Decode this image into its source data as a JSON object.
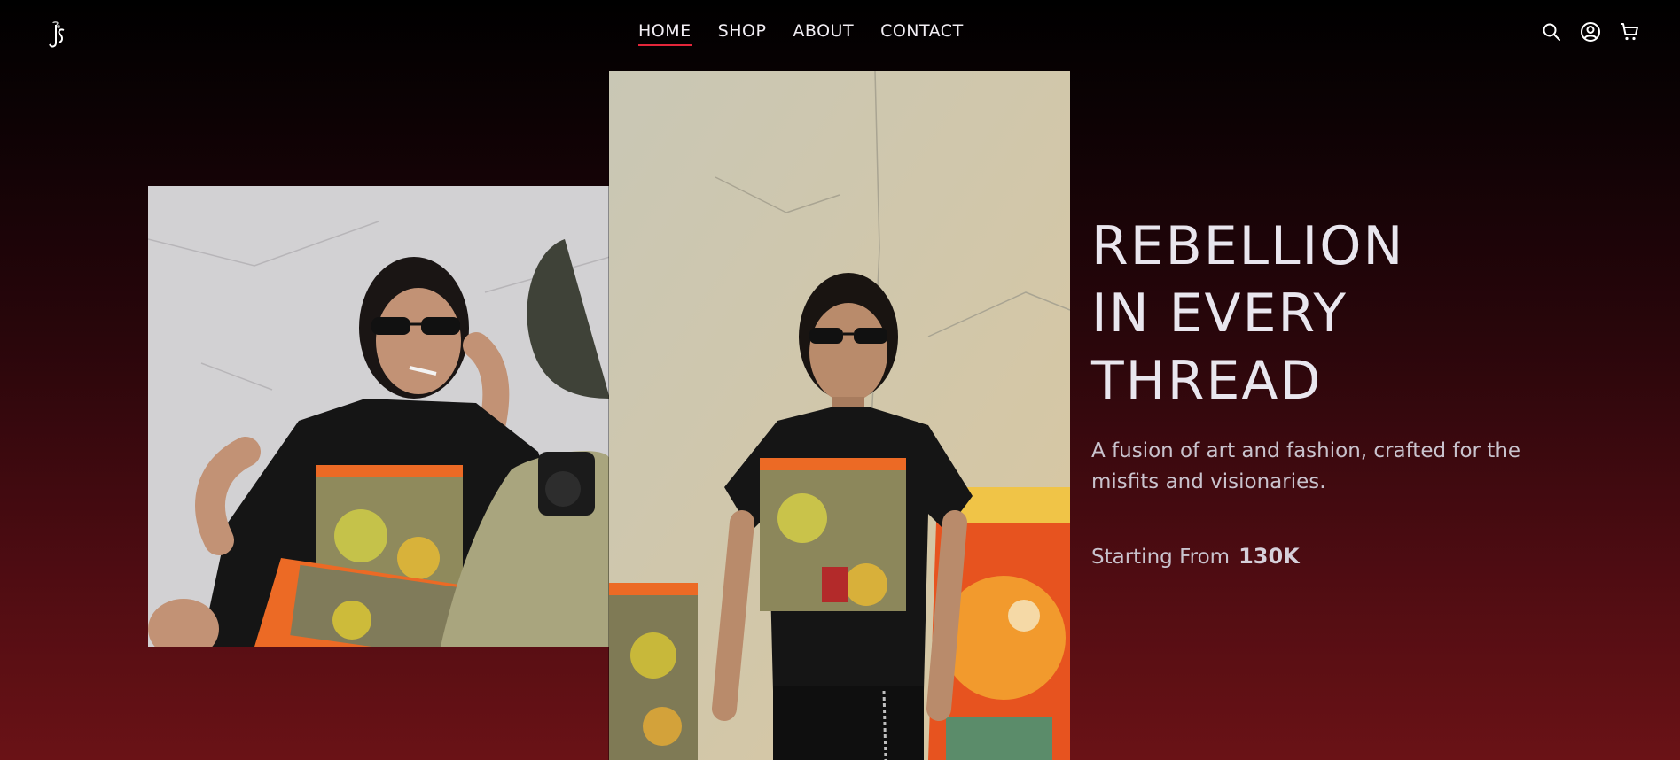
{
  "brand": {
    "logo_icon": "js-monogram-logo-icon"
  },
  "nav": {
    "items": [
      {
        "label": "HOME",
        "active": true
      },
      {
        "label": "SHOP",
        "active": false
      },
      {
        "label": "ABOUT",
        "active": false
      },
      {
        "label": "CONTACT",
        "active": false
      }
    ],
    "accent_color": "#e3263a"
  },
  "header_icons": [
    "search-icon",
    "account-icon",
    "cart-icon"
  ],
  "hero": {
    "title_lines": [
      "REBELLION",
      "IN EVERY",
      "THREAD"
    ],
    "subtitle": "A fusion of art and fashion, crafted for the misfits and visionaries.",
    "price_label": "Starting From",
    "price_value": "130K"
  },
  "images": {
    "left": "model-with-camera-photo",
    "center": "model-standing-wall-photo"
  },
  "colors": {
    "background_top": "#000000",
    "background_bottom": "#6a1216",
    "text": "#e9e6ee"
  }
}
